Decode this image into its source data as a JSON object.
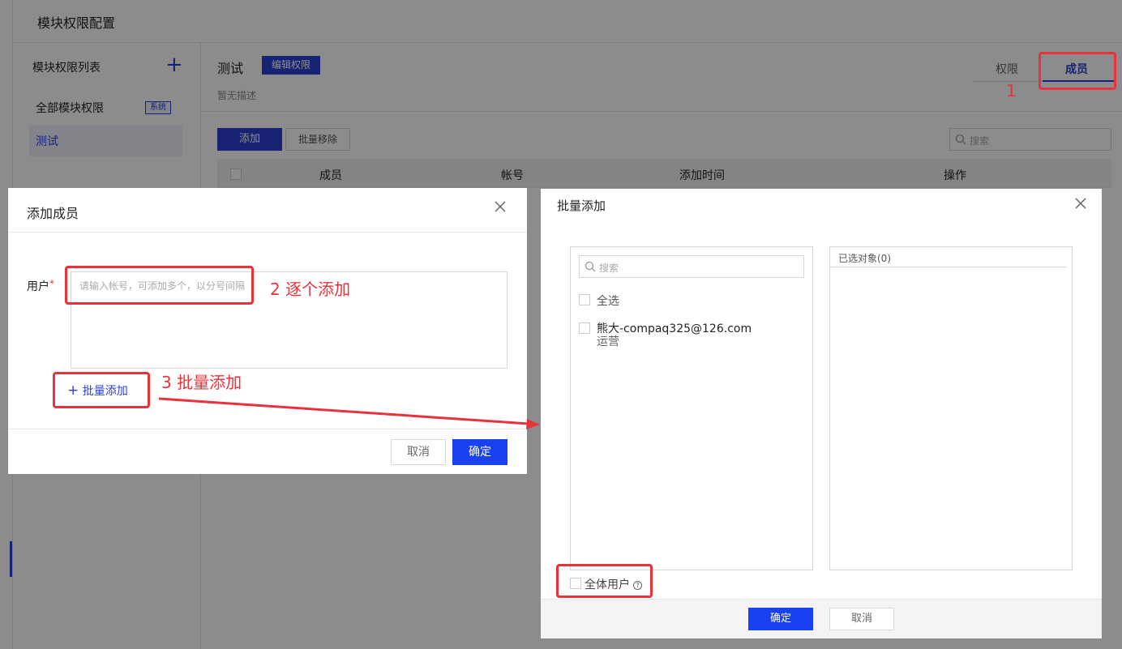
{
  "page": {
    "title": "模块权限配置"
  },
  "sidebar": {
    "title": "模块权限列表",
    "add_icon": "plus-icon",
    "items": [
      {
        "label": "全部模块权限",
        "badge": "系统"
      },
      {
        "label": "测试"
      }
    ]
  },
  "module": {
    "name": "测试",
    "edit_label": "编辑权限",
    "description": "暂无描述",
    "tabs": [
      {
        "label": "权限"
      },
      {
        "label": "成员"
      }
    ]
  },
  "toolbar": {
    "add_label": "添加",
    "batch_remove_label": "批量移除",
    "search_placeholder": "搜索"
  },
  "table": {
    "columns": [
      "成员",
      "帐号",
      "添加时间",
      "操作"
    ]
  },
  "add_member_dialog": {
    "title": "添加成员",
    "user_label": "用户",
    "required_mark": "*",
    "input_placeholder": "请输入帐号，可添加多个，以分号间隔",
    "batch_add_label": "批量添加",
    "cancel_label": "取消",
    "ok_label": "确定"
  },
  "batch_add_dialog": {
    "title": "批量添加",
    "search_placeholder": "搜索",
    "select_all_label": "全选",
    "users": [
      {
        "name": "熊大-compaq325@126.com",
        "dept": "运营"
      }
    ],
    "selected_header": "已选对象(0)",
    "all_users_label": "全体用户",
    "ok_label": "确定",
    "cancel_label": "取消"
  },
  "annotations": {
    "label_1": "1",
    "label_2": "2 逐个添加",
    "label_3": "3 批量添加"
  },
  "colors": {
    "accent": "#2b3fd6",
    "primary_button": "#1941f0",
    "annotation": "#e8323c"
  }
}
